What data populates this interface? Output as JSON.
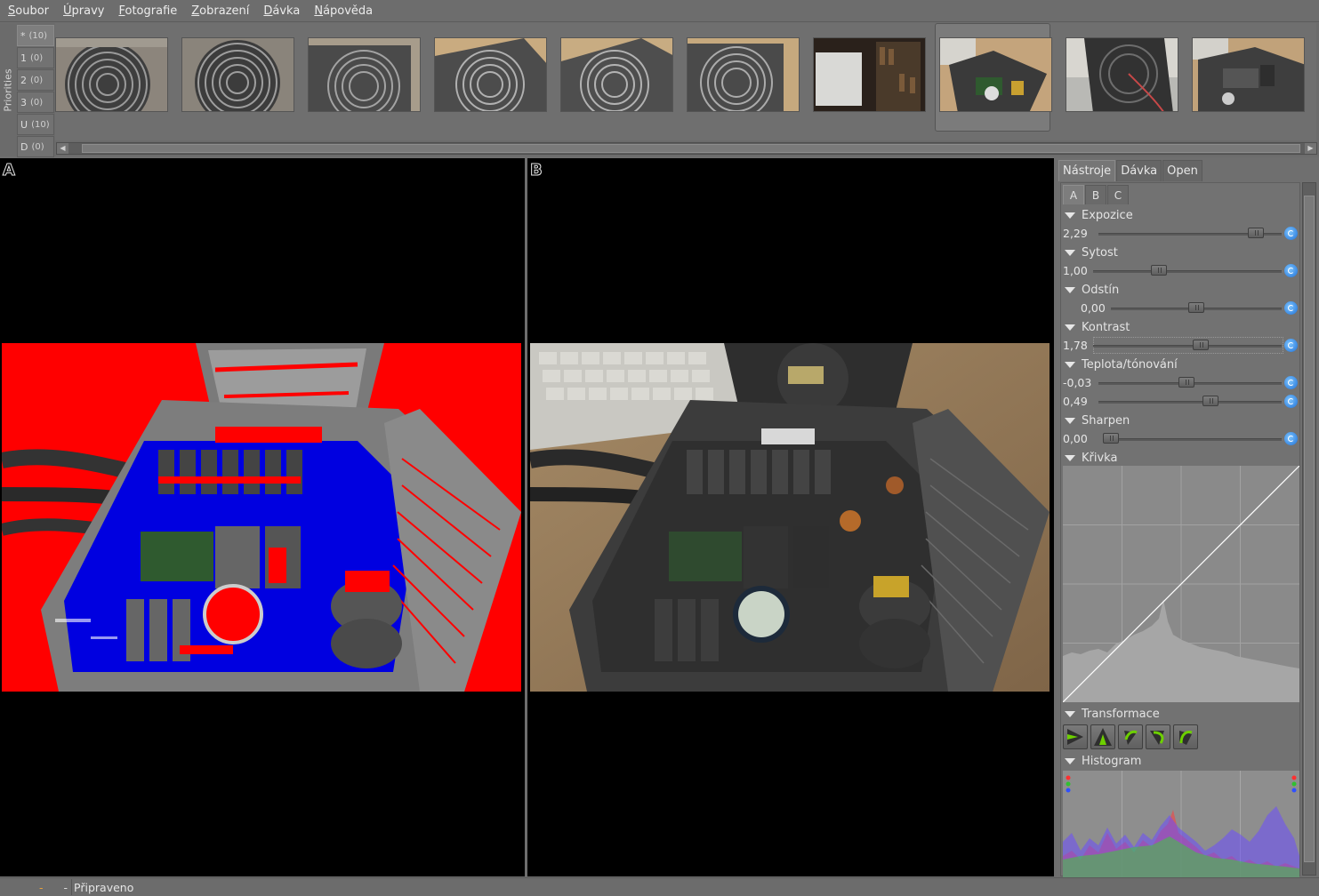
{
  "menubar": {
    "items": [
      {
        "first": "S",
        "rest": "oubor"
      },
      {
        "first": "Ú",
        "rest": "pravy"
      },
      {
        "first": "F",
        "rest": "otografie"
      },
      {
        "first": "Z",
        "rest": "obrazení"
      },
      {
        "first": "D",
        "rest": "ávka"
      },
      {
        "first": "N",
        "rest": "ápověda"
      }
    ]
  },
  "filmstrip": {
    "priorities_label": "Priorities",
    "priorities": [
      {
        "label": "*",
        "count": "(10)"
      },
      {
        "label": "1",
        "count": "(0)"
      },
      {
        "label": "2",
        "count": "(0)"
      },
      {
        "label": "3",
        "count": "(0)"
      },
      {
        "label": "U",
        "count": "(10)"
      },
      {
        "label": "D",
        "count": "(0)"
      }
    ],
    "selected_thumbnail": 8
  },
  "panes": {
    "a_label": "A",
    "b_label": "B"
  },
  "panel": {
    "main_tabs": [
      "Nástroje",
      "Dávka",
      "Open"
    ],
    "sub_tabs": [
      "A",
      "B",
      "C"
    ],
    "sections": {
      "exposure": {
        "title": "Expozice",
        "value": "2,29",
        "level": 0.86
      },
      "saturation": {
        "title": "Sytost",
        "value": "1,00",
        "level": 0.35
      },
      "hue": {
        "title": "Odstín",
        "value": "0,00",
        "level": 0.5
      },
      "contrast": {
        "title": "Kontrast",
        "value": "1,78",
        "level": 0.57
      },
      "temperature": {
        "title": "Teplota/tónování",
        "value1": "-0,03",
        "level1": 0.48,
        "value2": "0,49",
        "level2": 0.61
      },
      "sharpen": {
        "title": "Sharpen",
        "value": "0,00",
        "level": 0.02
      },
      "curve": {
        "title": "Křivka"
      },
      "transform": {
        "title": "Transformace"
      },
      "histogram": {
        "title": "Histogram"
      }
    }
  },
  "status": {
    "dash1": "-",
    "dash2": "-",
    "message": "Připraveno"
  },
  "icons": {
    "reset": "reset-icon",
    "collapse": "triangle-down-icon",
    "transform": [
      "flip-horizontal-icon",
      "flip-vertical-icon",
      "rotate-left-icon",
      "rotate-right-icon",
      "free-rotate-icon"
    ]
  }
}
